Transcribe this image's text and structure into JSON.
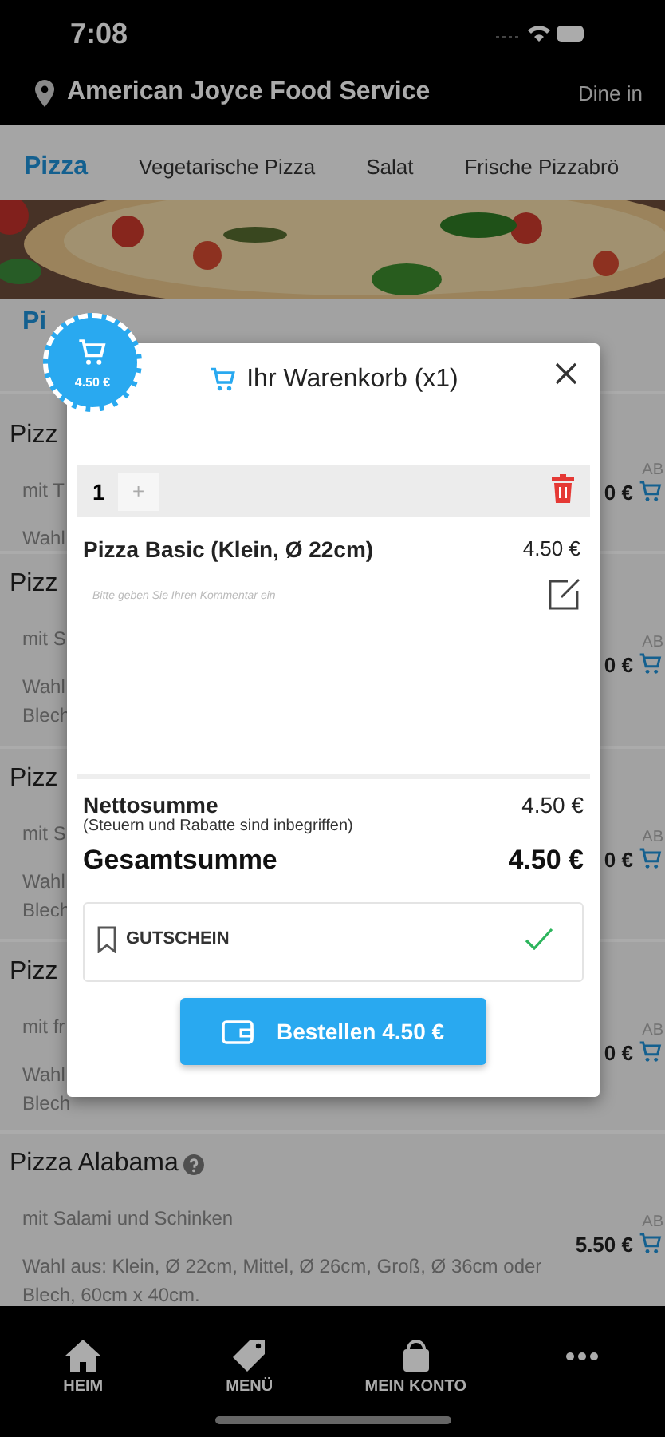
{
  "status_bar": {
    "time": "7:08"
  },
  "header": {
    "location": "American Joyce Food Service",
    "mode": "Dine in"
  },
  "category_tabs": [
    {
      "label": "Pizza",
      "selected": true
    },
    {
      "label": "Vegetarische Pizza",
      "selected": false
    },
    {
      "label": "Salat",
      "selected": false
    },
    {
      "label": "Frische Pizzabrö",
      "selected": false
    }
  ],
  "section_title": "Pi",
  "products": [
    {
      "name": "Pizz",
      "description": "mit T",
      "options_lines": [
        "Wahl"
      ],
      "price_prefix": "AB",
      "price": "0 €"
    },
    {
      "name": "Pizz",
      "description": "mit S",
      "options_lines": [
        "Wahl",
        "Blech"
      ],
      "price_prefix": "AB",
      "price": "0 €"
    },
    {
      "name": "Pizz",
      "description": "mit S",
      "options_lines": [
        "Wahl",
        "Blech"
      ],
      "price_prefix": "AB",
      "price": "0 €"
    },
    {
      "name": "Pizz",
      "description": "mit fr",
      "options_lines": [
        "Wahl",
        "Blech"
      ],
      "price_prefix": "AB",
      "price": "0 €"
    },
    {
      "name": "Pizza Alabama",
      "has_info": true,
      "description": "mit Salami und Schinken",
      "options_lines": [
        "Wahl aus: Klein, Ø 22cm, Mittel, Ø 26cm, Groß, Ø 36cm oder",
        "Blech, 60cm x 40cm."
      ],
      "price_prefix": "AB",
      "price": "5.50 €"
    }
  ],
  "cart_badge": {
    "amount": "4.50 €"
  },
  "cart": {
    "title": "Ihr Warenkorb (x1)",
    "quantity": "1",
    "increment": "+",
    "items": [
      {
        "name": "Pizza Basic (Klein, Ø 22cm)",
        "price": "4.50 €",
        "comment_placeholder": "Bitte geben Sie Ihren Kommentar ein"
      }
    ],
    "net_label": "Nettosumme",
    "net_value": "4.50 €",
    "tax_note": "(Steuern und Rabatte sind inbegriffen)",
    "total_label": "Gesamtsumme",
    "total_value": "4.50 €",
    "voucher": {
      "label": "GUTSCHEIN",
      "applied": true
    },
    "order_button": "Bestellen 4.50 €"
  },
  "bottom_nav": [
    {
      "kind": "home",
      "label": "HEIM"
    },
    {
      "kind": "tag",
      "label": "MENÜ"
    },
    {
      "kind": "bag",
      "label": "MEIN KONTO"
    },
    {
      "kind": "more"
    }
  ]
}
